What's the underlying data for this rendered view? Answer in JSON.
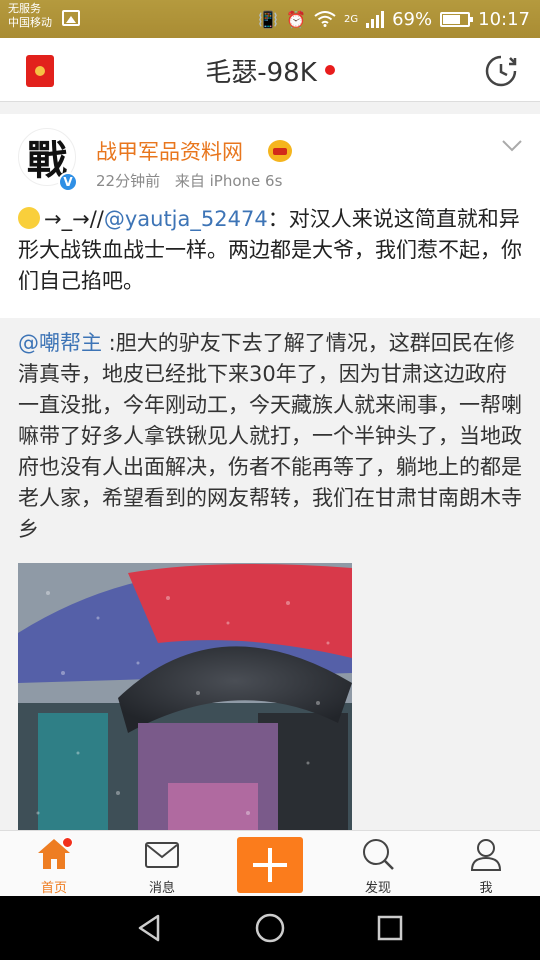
{
  "status_bar": {
    "carrier_line1": "无服务",
    "carrier_line2": "中国移动",
    "network": "2G",
    "battery": "69%",
    "battery_level": 0.69,
    "time": "10:17"
  },
  "header": {
    "title": "毛瑟-98K",
    "left_icon": "red-packet-icon",
    "right_icon": "history-icon"
  },
  "post": {
    "avatar_char": "戰",
    "verified_badge": "V",
    "author": "战甲军品资料网",
    "time_ago": "22分钟前",
    "source": "来自 iPhone 6s",
    "text_prefix": "→_→//",
    "mention": "@yautja_52474",
    "text": "：对汉人来说这简直就和异形大战铁血战士一样。两边都是大爷，我们惹不起，你们自己掐吧。"
  },
  "repost": {
    "mention": "@嘲帮主",
    "text": " :胆大的驴友下去了解了情况，这群回民在修清真寺，地皮已经批下来30年了，因为甘肃这边政府一直没批，今年刚动工，今天藏族人就来闹事，一帮喇嘛带了好多人拿铁锹见人就打，一个半钟头了，当地政府也没有人出面解决，伤者不能再等了，躺地上的都是老人家，希望看到的网友帮转，我们在甘肃甘南朗木寺乡"
  },
  "tabs": [
    {
      "label": "首页",
      "icon": "home-icon",
      "active": true
    },
    {
      "label": "消息",
      "icon": "message-icon",
      "active": false
    },
    {
      "label": "",
      "icon": "compose-plus-icon",
      "active": false
    },
    {
      "label": "发现",
      "icon": "discover-search-icon",
      "active": false
    },
    {
      "label": "我",
      "icon": "profile-icon",
      "active": false
    }
  ],
  "colors": {
    "accent": "#fb7c1c",
    "author": "#e8761d",
    "mention": "#3d74b6",
    "status_bar": "#b09436"
  }
}
